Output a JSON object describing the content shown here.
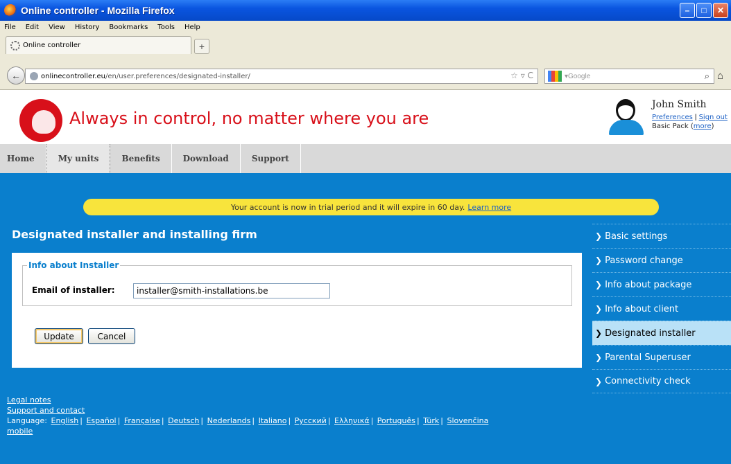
{
  "window": {
    "title": "Online controller - Mozilla Firefox"
  },
  "menubar": [
    "File",
    "Edit",
    "View",
    "History",
    "Bookmarks",
    "Tools",
    "Help"
  ],
  "tab": {
    "label": "Online controller"
  },
  "navbar": {
    "url_host": "onlinecontroller.eu",
    "url_path": "/en/user.preferences/designated-installer/",
    "search_placeholder": "Google"
  },
  "header": {
    "logo_text": "Online controller",
    "slogan": "Always in control, no matter where you are",
    "user_name": "John Smith",
    "preferences_label": "Preferences",
    "signout_label": "Sign out",
    "pack_label": "Basic Pack (",
    "more_label": "more",
    "pack_close": ")"
  },
  "sitenav": [
    "Home",
    "My units",
    "Benefits",
    "Download",
    "Support"
  ],
  "trial": {
    "text": "Your account is now in trial period and it will expire in 60 day.",
    "link": "Learn more"
  },
  "page": {
    "title": "Designated installer and installing firm",
    "fieldset_legend": "Info about Installer",
    "email_label": "Email of installer:",
    "email_value": "installer@smith-installations.be",
    "update_label": "Update",
    "cancel_label": "Cancel"
  },
  "sidebar": {
    "items": [
      {
        "label": "Basic settings",
        "active": false
      },
      {
        "label": "Password change",
        "active": false
      },
      {
        "label": "Info about package",
        "active": false
      },
      {
        "label": "Info about client",
        "active": false
      },
      {
        "label": "Designated installer",
        "active": true
      },
      {
        "label": "Parental Superuser",
        "active": false
      },
      {
        "label": "Connectivity check",
        "active": false
      }
    ]
  },
  "footer": {
    "legal": "Legal notes",
    "support": "Support and contact",
    "language_prefix": "Language:",
    "languages": [
      "English",
      "Español",
      "Française",
      "Deutsch",
      "Nederlands",
      "Italiano",
      "Русский",
      "Ελληνικά",
      "Português",
      "Türk",
      "Slovenčina"
    ],
    "mobile": "mobile"
  },
  "colors": {
    "brand_red": "#d8101a",
    "main_blue": "#0a7fcd",
    "trial_yellow": "#f8e43c",
    "active_side": "#b9e1f7"
  }
}
